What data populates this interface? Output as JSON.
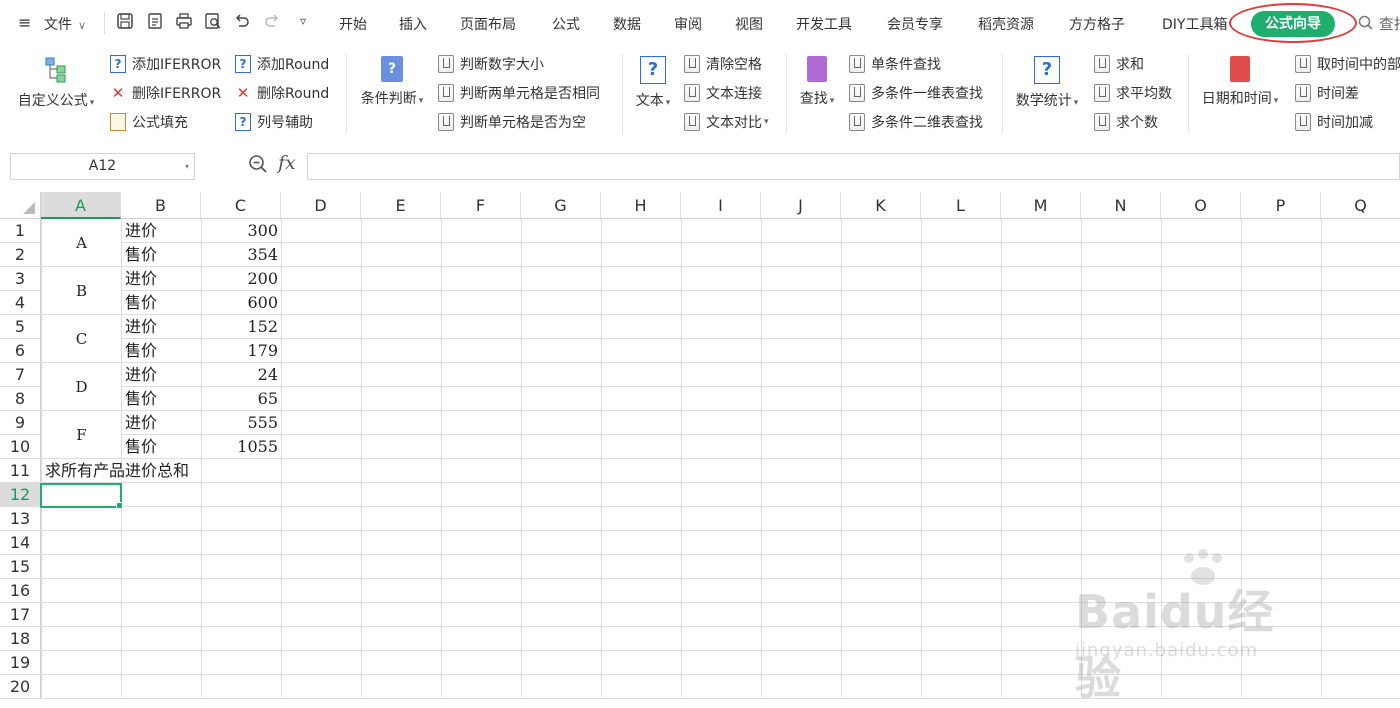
{
  "menubar": {
    "file_label": "文件",
    "tabs": [
      "开始",
      "插入",
      "页面布局",
      "公式",
      "数据",
      "审阅",
      "视图",
      "开发工具",
      "会员专享",
      "稻壳资源",
      "方方格子",
      "DIY工具箱"
    ],
    "active_tab": "公式向导",
    "search_label": "查找"
  },
  "ribbon": {
    "custom_formula": "自定义公式",
    "add_iferror": "添加IFERROR",
    "del_iferror": "删除IFERROR",
    "formula_fill": "公式填充",
    "add_round": "添加Round",
    "del_round": "删除Round",
    "col_helper": "列号辅助",
    "cond_judge": "条件判断",
    "judge_num_size": "判断数字大小",
    "judge_two_cells": "判断两单元格是否相同",
    "judge_empty": "判断单元格是否为空",
    "text": "文本",
    "clear_space": "清除空格",
    "text_join": "文本连接",
    "text_compare": "文本对比",
    "lookup": "查找",
    "single_lookup": "单条件查找",
    "multi_1d_lookup": "多条件一维表查找",
    "multi_2d_lookup": "多条件二维表查找",
    "math_stats": "数学统计",
    "sum": "求和",
    "average": "求平均数",
    "count": "求个数",
    "datetime": "日期和时间",
    "extract_time": "取时间中的部",
    "time_diff": "时间差",
    "time_add": "时间加减"
  },
  "formula_bar": {
    "name_box": "A12",
    "fx": "fx",
    "formula": ""
  },
  "sheet": {
    "columns": [
      "A",
      "B",
      "C",
      "D",
      "E",
      "F",
      "G",
      "H",
      "I",
      "J",
      "K",
      "L",
      "M",
      "N",
      "O",
      "P",
      "Q"
    ],
    "rows": [
      "1",
      "2",
      "3",
      "4",
      "5",
      "6",
      "7",
      "8",
      "9",
      "10",
      "11",
      "12",
      "13",
      "14",
      "15",
      "16",
      "17",
      "18",
      "19",
      "20"
    ],
    "selected_column": "A",
    "selected_row": "12",
    "products": [
      {
        "name": "A",
        "rows": [
          {
            "label": "进价",
            "value": "300"
          },
          {
            "label": "售价",
            "value": "354"
          }
        ]
      },
      {
        "name": "B",
        "rows": [
          {
            "label": "进价",
            "value": "200"
          },
          {
            "label": "售价",
            "value": "600"
          }
        ]
      },
      {
        "name": "C",
        "rows": [
          {
            "label": "进价",
            "value": "152"
          },
          {
            "label": "售价",
            "value": "179"
          }
        ]
      },
      {
        "name": "D",
        "rows": [
          {
            "label": "进价",
            "value": "24"
          },
          {
            "label": "售价",
            "value": "65"
          }
        ]
      },
      {
        "name": "F",
        "rows": [
          {
            "label": "进价",
            "value": "555"
          },
          {
            "label": "售价",
            "value": "1055"
          }
        ]
      }
    ],
    "a11": "求所有产品进价总和"
  },
  "watermark": {
    "brand": "Baidu经验",
    "url": "jingyan.baidu.com"
  },
  "colors": {
    "accent_green": "#1fae6e",
    "highlight_red": "#e03a3a"
  }
}
